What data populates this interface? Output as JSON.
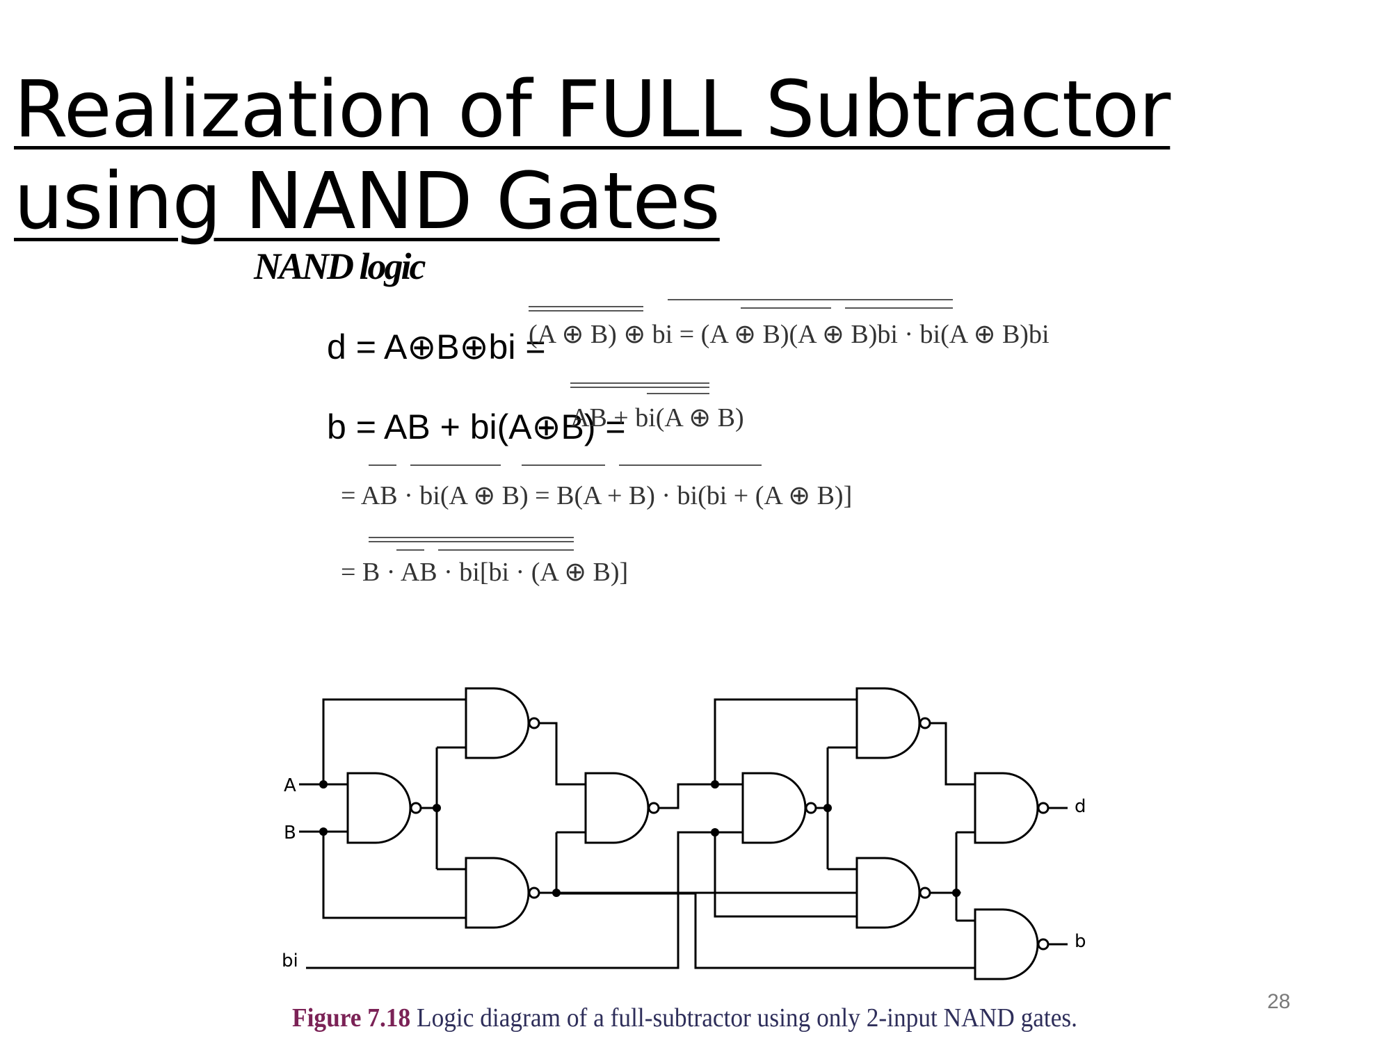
{
  "slide": {
    "title": "Realization of FULL Subtractor using NAND Gates",
    "page_number": "28"
  },
  "equations": {
    "heading": "NAND logic",
    "d_lhs": "d = A⊕B⊕bi =",
    "d_rhs": "(A ⊕ B) ⊕ bi = (A ⊕ B)(A ⊕ B)bi · bi(A ⊕ B)bi",
    "b_lhs": "b = AB + bi(A⊕B) =",
    "b_rhs": "AB + bi(A ⊕ B)",
    "b_step2": "= AB · bi(A ⊕ B) = B(A + B) · bi(bi + (A ⊕ B)]",
    "b_step3": "= B · AB · bi[bi · (A ⊕ B)]"
  },
  "diagram": {
    "inputs": [
      "A",
      "B",
      "bi"
    ],
    "outputs": [
      "d",
      "b"
    ],
    "gate_type": "NAND",
    "gate_count": 9
  },
  "caption": {
    "label": "Figure 7.18",
    "text": "Logic diagram of a full-subtractor using only 2-input NAND gates."
  }
}
